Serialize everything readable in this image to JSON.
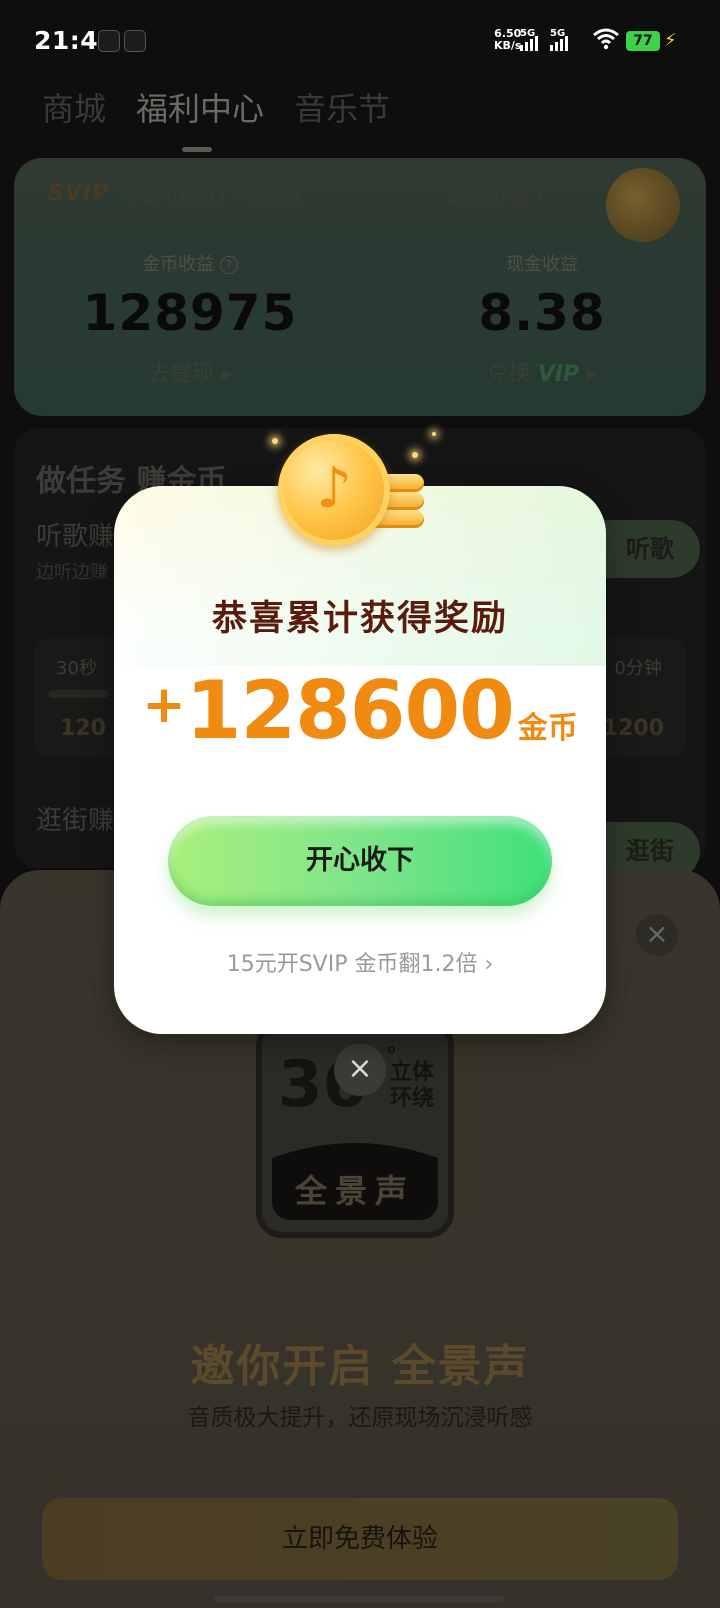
{
  "status_bar": {
    "time": "21:47",
    "net_speed_value": "6.50",
    "net_speed_unit": "KB/s",
    "sim1": "5G",
    "sim2": "5G",
    "battery": "77"
  },
  "tabs": [
    {
      "label": "商城"
    },
    {
      "label": "福利中心"
    },
    {
      "label": "音乐节"
    }
  ],
  "svip_banner": {
    "logo": "SVIP",
    "text": "享金币获取1.2倍加速",
    "action": "15元开通 ›"
  },
  "earnings": {
    "coins_label": "金币收益",
    "coins_value": "128975",
    "coins_action": "去提现 ▸",
    "cash_label": "现金收益",
    "cash_value": "8.38",
    "cash_action_prefix": "兑换",
    "cash_action_vip": "VIP",
    "cash_action_suffix": "▸"
  },
  "tasks": {
    "title": "做任务 赚金币",
    "listen_title": "听歌赚",
    "listen_sub": "边听边赚",
    "listen_button": "听歌",
    "strip_left_time": "30秒",
    "strip_left_reward": "120",
    "strip_right_time": "0分钟",
    "strip_right_reward": "1200",
    "shop_title": "逛街赚",
    "shop_button": "逛街"
  },
  "sheet": {
    "badge_number": "36",
    "badge_degree": "°",
    "badge_line1": "立体",
    "badge_line2": "环绕",
    "badge_word": "全景声",
    "headline": "邀你开启 全景声",
    "subline": "音质极大提升，还原现场沉浸听感",
    "cta": "立即免费体验"
  },
  "modal": {
    "heading": "恭喜累计获得奖励",
    "amount_plus": "+",
    "amount_value": "128600",
    "amount_unit": "金币",
    "accept_button": "开心收下",
    "promo": "15元开SVIP 金币翻1.2倍 ›"
  },
  "icons": {
    "close": "×",
    "coin_symbol": "♪"
  },
  "colors": {
    "accent_orange": "#f08a10",
    "accept_green": "#3fe07a",
    "heading_brown": "#5a1a0c"
  }
}
